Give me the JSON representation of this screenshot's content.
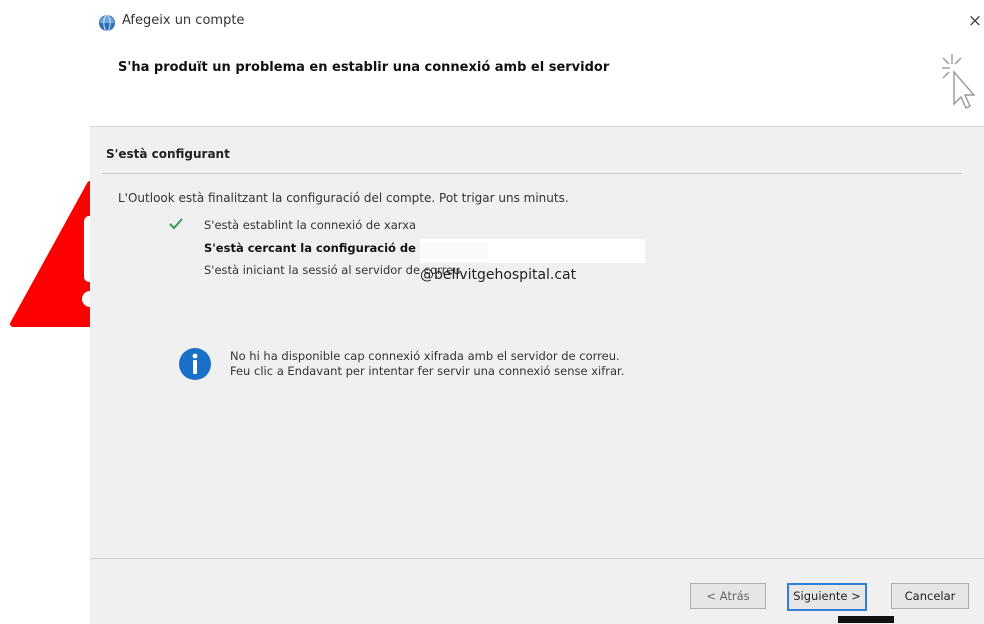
{
  "window": {
    "title": "Afegeix un compte",
    "close_symbol": "×",
    "header_title": "S'ha produït un problema en establir una connexió amb el servidor",
    "icons": {
      "app": "outlook-globe-icon",
      "cursor": "sparkle-cursor-icon"
    }
  },
  "section": {
    "title": "S'està configurant",
    "intro": "L'Outlook està finalitzant la configuració del compte. Pot trigar uns minuts."
  },
  "steps": [
    {
      "label": "S'està establint la connexió de xarxa",
      "status": "done"
    },
    {
      "label": "S'està cercant la configuració de",
      "status": "active"
    },
    {
      "label": "S'està iniciant la sessió al servidor de correu",
      "status": "pending"
    }
  ],
  "email": {
    "domain": "@bellvitgehospital.cat"
  },
  "info": {
    "line1": "No hi ha disponible cap connexió xifrada amb el servidor de correu.",
    "line2": "Feu clic a Endavant per intentar fer servir una connexió sense xifrar."
  },
  "buttons": {
    "back": "< Atrás",
    "next": "Siguiente >",
    "cancel": "Cancelar"
  },
  "colors": {
    "warning": "#ff0000",
    "info": "#1a6fc9",
    "check": "#3a9a5b",
    "accent": "#2f7ed8"
  }
}
